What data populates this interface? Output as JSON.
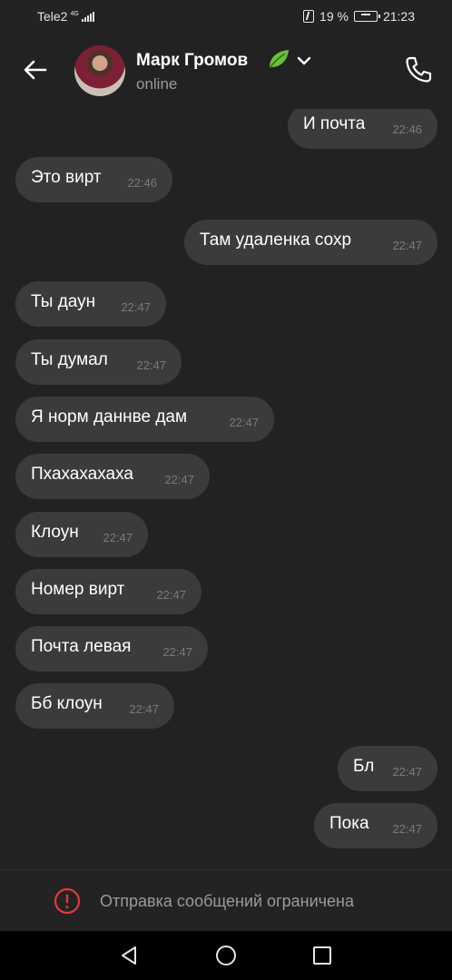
{
  "status_bar": {
    "carrier": "Tele2",
    "network_type": "4G",
    "battery_percent": "19 %",
    "time": "21:23"
  },
  "header": {
    "contact_name": "Марк Громов",
    "contact_status": "online"
  },
  "messages": [
    {
      "text": "И почта",
      "time": "22:46",
      "side": "outgoing"
    },
    {
      "text": "Это вирт",
      "time": "22:46",
      "side": "incoming"
    },
    {
      "text": "Там удаленка сохр",
      "time": "22:47",
      "side": "outgoing"
    },
    {
      "text": "Ты даун",
      "time": "22:47",
      "side": "incoming"
    },
    {
      "text": "Ты думал",
      "time": "22:47",
      "side": "incoming"
    },
    {
      "text": "Я норм даннве дам",
      "time": "22:47",
      "side": "incoming"
    },
    {
      "text": "Пхахахахаха",
      "time": "22:47",
      "side": "incoming"
    },
    {
      "text": "Клоун",
      "time": "22:47",
      "side": "incoming"
    },
    {
      "text": "Номер вирт",
      "time": "22:47",
      "side": "incoming"
    },
    {
      "text": "Почта левая",
      "time": "22:47",
      "side": "incoming"
    },
    {
      "text": "Бб клоун",
      "time": "22:47",
      "side": "incoming"
    },
    {
      "text": "Бл",
      "time": "22:47",
      "side": "outgoing"
    },
    {
      "text": "Пока",
      "time": "22:47",
      "side": "outgoing"
    }
  ],
  "restricted": {
    "label": "Отправка сообщений ограничена"
  },
  "colors": {
    "background": "#222222",
    "bubble": "#3b3b3b",
    "alert": "#e53935",
    "leaf": "#6abf3b"
  },
  "icons": {
    "back": "back-arrow-icon",
    "leaf": "leaf-icon",
    "chevron": "chevron-down-icon",
    "call": "phone-icon",
    "alert": "alert-circle-icon",
    "nav_back": "nav-back-icon",
    "nav_home": "nav-home-icon",
    "nav_recent": "nav-recent-icon"
  }
}
